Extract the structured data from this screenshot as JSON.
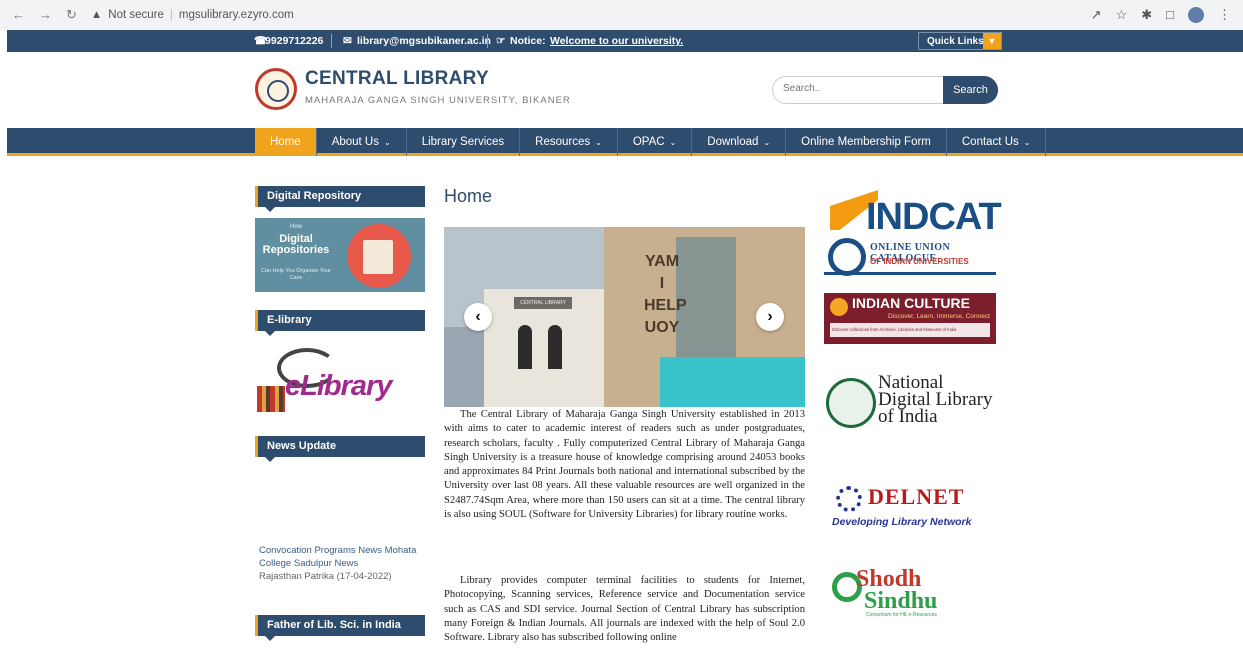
{
  "browser": {
    "back_icon": "arrow-left-icon",
    "forward_icon": "arrow-right-icon",
    "reload_icon": "reload-icon",
    "security_label": "Not secure",
    "url": "mgsulibrary.ezyro.com"
  },
  "topbar": {
    "phone": "9929712226",
    "email": "library@mgsubikaner.ac.in",
    "notice_label": "Notice:",
    "notice_text": "Welcome to our university.",
    "quick_links": "Quick Links"
  },
  "header": {
    "title": "CENTRAL LIBRARY",
    "subtitle": "MAHARAJA GANGA SINGH UNIVERSITY, BIKANER",
    "search_placeholder": "Search..",
    "search_button": "Search"
  },
  "menu": [
    {
      "label": "Home",
      "dropdown": false,
      "active": true
    },
    {
      "label": "About Us",
      "dropdown": true
    },
    {
      "label": "Library Services",
      "dropdown": false
    },
    {
      "label": "Resources",
      "dropdown": true
    },
    {
      "label": "OPAC",
      "dropdown": true
    },
    {
      "label": "Download",
      "dropdown": true
    },
    {
      "label": "Online Membership Form",
      "dropdown": false
    },
    {
      "label": "Contact Us",
      "dropdown": true
    }
  ],
  "sidebar": {
    "digital_repository": "Digital Repository",
    "dr_banner_top": "How",
    "dr_banner_main": "Digital Repositories",
    "dr_banner_sub": "Can Help You Organize Your Case",
    "elibrary": "E-library",
    "elibrary_word": "eLibrary",
    "news_update": "News Update",
    "news_items": [
      "Convocation Programs News Mohata College Sadulpur News",
      "Rajasthan Patrika (17-04-2022)"
    ],
    "father_title": "Father of Lib. Sci. in India"
  },
  "main": {
    "page_title": "Home",
    "slide_text": "YAM I HELP UOY",
    "slide_sign": "CENTRAL LIBRARY",
    "paragraph1": "The Central Library of Maharaja Ganga Singh University established in 2013 with aims to cater to academic interest of readers such as under postgraduates, research scholars, faculty . Fully computerized Central Library of Maharaja Ganga Singh University is a treasure house of knowledge comprising around 24053 books and approximates 84 Print Journals both national and international subscribed by the University over last 08 years. All these valuable resources are well organized in the S2487.74Sqm Area, where more than 150 users can sit at a time. The central library is also using SOUL (Software for University Libraries) for library routine works.",
    "paragraph2": "Library provides computer terminal facilities to students for Internet, Photocopying, Scanning services, Reference service and Documentation service such as CAS and SDI service. Journal Section of Central Library has subscription many Foreign & Indian Journals. All journals are indexed with the help of Soul 2.0 Software. Library also has subscribed following online"
  },
  "right": {
    "indcat_title": "INDCAT",
    "indcat_line1": "ONLINE UNION CATALOGUE",
    "indcat_line2": "OF INDIAN UNIVERSITIES",
    "indian_culture": "INDIAN CULTURE",
    "indian_culture_tag": "Discover, Learn, Immerse, Connect",
    "indian_culture_strip": "Discover collections from Archives, Libraries and Museums of India",
    "ndl_title": "National Digital Library of India",
    "delnet_title": "DELNET",
    "delnet_sub": "Developing Library Network",
    "shodh_title": "Shodh",
    "shodh_title2": "Sindhu",
    "shodh_sub": "Consortium for HE e-Resources"
  },
  "colors": {
    "primary": "#2e4c6d",
    "accent": "#f0a31c"
  }
}
